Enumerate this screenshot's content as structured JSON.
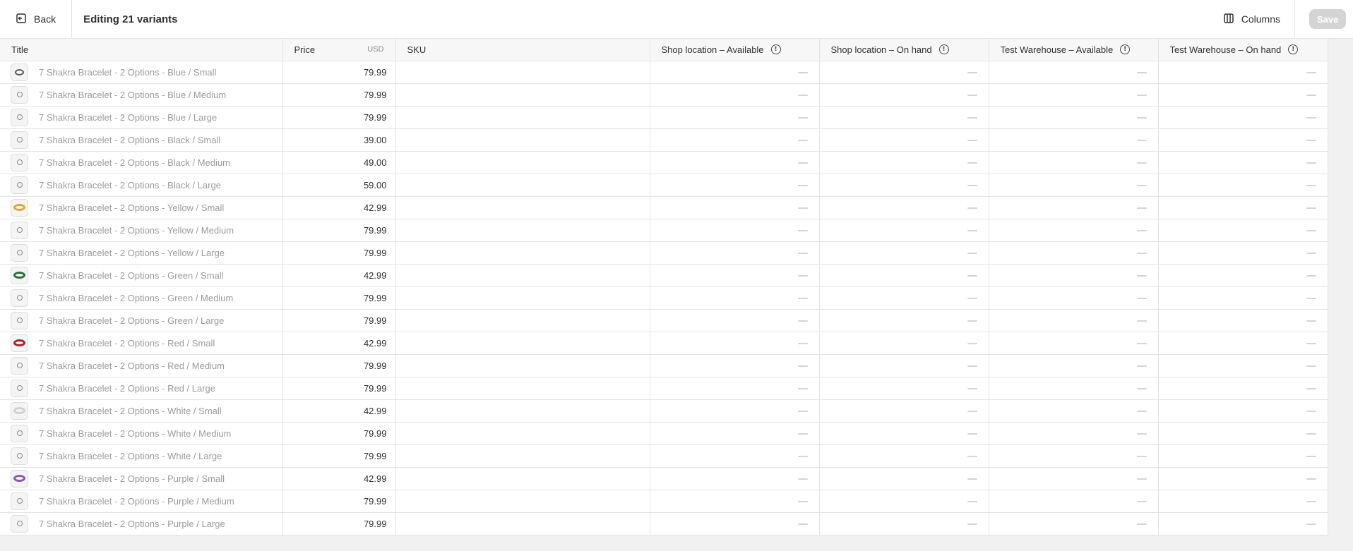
{
  "header": {
    "back_label": "Back",
    "title": "Editing 21 variants",
    "columns_label": "Columns",
    "save_label": "Save"
  },
  "table": {
    "columns": {
      "title": "Title",
      "price": "Price",
      "currency": "USD",
      "sku": "SKU",
      "shop_available": "Shop location – Available",
      "shop_on_hand": "Shop location – On hand",
      "warehouse_available": "Test Warehouse – Available",
      "warehouse_on_hand": "Test Warehouse – On hand"
    },
    "rows": [
      {
        "title": "7 Shakra Bracelet - 2 Options - Blue / Small",
        "price": "79.99",
        "thumb": "ring-dark"
      },
      {
        "title": "7 Shakra Bracelet - 2 Options - Blue / Medium",
        "price": "79.99",
        "thumb": "ring-small"
      },
      {
        "title": "7 Shakra Bracelet - 2 Options - Blue / Large",
        "price": "79.99",
        "thumb": "ring-small"
      },
      {
        "title": "7 Shakra Bracelet - 2 Options - Black / Small",
        "price": "39.00",
        "thumb": "ring-small"
      },
      {
        "title": "7 Shakra Bracelet - 2 Options - Black / Medium",
        "price": "49.00",
        "thumb": "ring-small"
      },
      {
        "title": "7 Shakra Bracelet - 2 Options - Black / Large",
        "price": "59.00",
        "thumb": "ring-small"
      },
      {
        "title": "7 Shakra Bracelet - 2 Options - Yellow / Small",
        "price": "42.99",
        "thumb": "ring-yellow"
      },
      {
        "title": "7 Shakra Bracelet - 2 Options - Yellow / Medium",
        "price": "79.99",
        "thumb": "ring-small"
      },
      {
        "title": "7 Shakra Bracelet - 2 Options - Yellow / Large",
        "price": "79.99",
        "thumb": "ring-small"
      },
      {
        "title": "7 Shakra Bracelet - 2 Options - Green / Small",
        "price": "42.99",
        "thumb": "ring-green"
      },
      {
        "title": "7 Shakra Bracelet - 2 Options - Green / Medium",
        "price": "79.99",
        "thumb": "ring-small"
      },
      {
        "title": "7 Shakra Bracelet - 2 Options - Green / Large",
        "price": "79.99",
        "thumb": "ring-small"
      },
      {
        "title": "7 Shakra Bracelet - 2 Options - Red / Small",
        "price": "42.99",
        "thumb": "ring-red"
      },
      {
        "title": "7 Shakra Bracelet - 2 Options - Red / Medium",
        "price": "79.99",
        "thumb": "ring-small"
      },
      {
        "title": "7 Shakra Bracelet - 2 Options - Red / Large",
        "price": "79.99",
        "thumb": "ring-small"
      },
      {
        "title": "7 Shakra Bracelet - 2 Options - White / Small",
        "price": "42.99",
        "thumb": "ring-white"
      },
      {
        "title": "7 Shakra Bracelet - 2 Options - White / Medium",
        "price": "79.99",
        "thumb": "ring-small"
      },
      {
        "title": "7 Shakra Bracelet - 2 Options - White / Large",
        "price": "79.99",
        "thumb": "ring-small"
      },
      {
        "title": "7 Shakra Bracelet - 2 Options - Purple / Small",
        "price": "42.99",
        "thumb": "ring-purple"
      },
      {
        "title": "7 Shakra Bracelet - 2 Options - Purple / Medium",
        "price": "79.99",
        "thumb": "ring-small"
      },
      {
        "title": "7 Shakra Bracelet - 2 Options - Purple / Large",
        "price": "79.99",
        "thumb": "ring-small"
      }
    ]
  },
  "colors": {
    "ring-dark": "#5a5a5a",
    "ring-small": "#8a8a8a",
    "ring-yellow": "#d9a93a",
    "ring-green": "#2f6b3a",
    "ring-red": "#a4222a",
    "ring-white": "#d6cfcf",
    "ring-purple": "#8a5aa8"
  }
}
